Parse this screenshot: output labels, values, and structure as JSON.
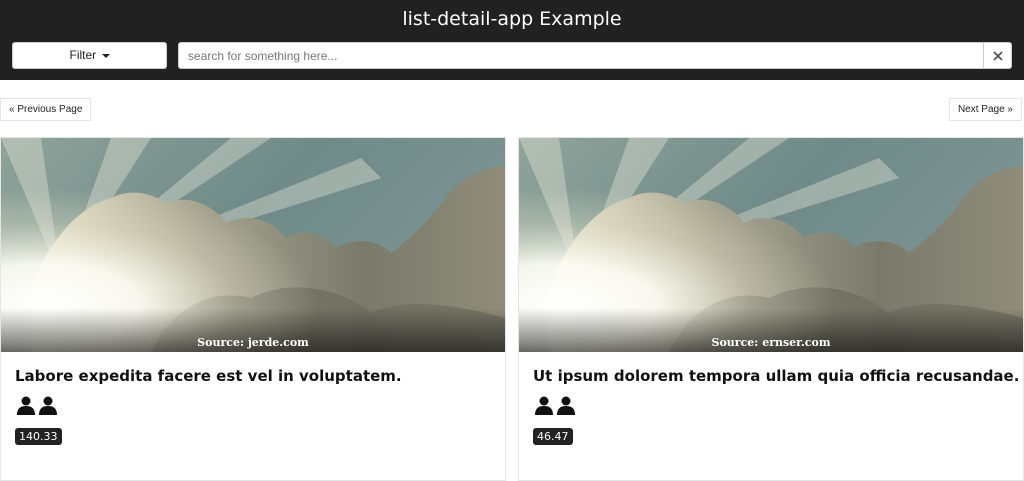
{
  "app": {
    "title": "list-detail-app Example"
  },
  "toolbar": {
    "filter_label": "Filter",
    "search_placeholder": "search for something here...",
    "search_value": ""
  },
  "pagination": {
    "previous_label": "« Previous Page",
    "next_label": "Next Page »"
  },
  "cards": [
    {
      "source": "Source: jerde.com",
      "title": "Labore expedita facere est vel in voluptatem.",
      "price": "140.33",
      "icons": [
        "person-icon",
        "person-icon"
      ]
    },
    {
      "source": "Source: ernser.com",
      "title": "Ut ipsum dolorem tempora ullam quia officia recusandae.",
      "price": "46.47",
      "icons": [
        "person-icon",
        "person-icon"
      ]
    }
  ],
  "colors": {
    "topbar": "#212121",
    "badge": "#222222"
  }
}
